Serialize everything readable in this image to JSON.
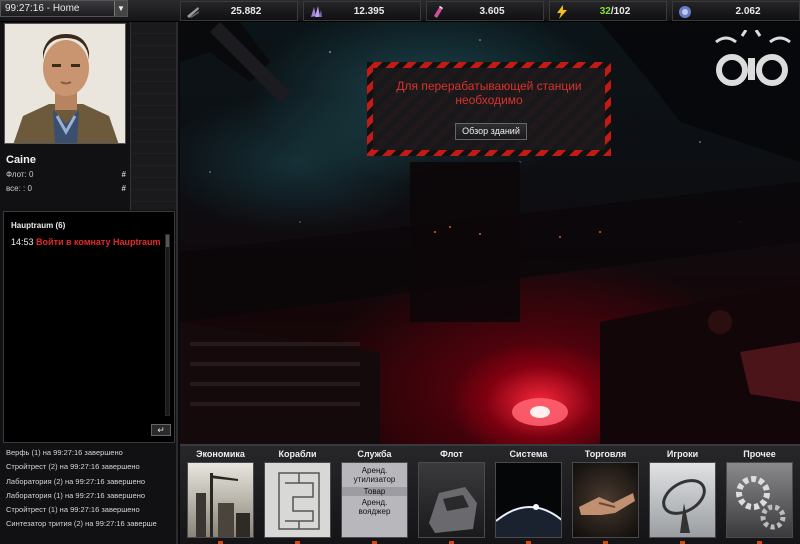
{
  "topbar": {
    "clock": "99:27:16 - Home",
    "dropdown_glyph": "▼",
    "resources": {
      "metal": "25.882",
      "crystal": "12.395",
      "tritium": "3.605",
      "energy_current": "32",
      "energy_max": "/102",
      "credits": "2.062"
    }
  },
  "player": {
    "name": "Caine",
    "fleet_label": "Флот: 0",
    "all_label": "все: : 0",
    "hash": "#"
  },
  "chat": {
    "title": "Hauptraum (6)",
    "time": "14:53",
    "message": "Войти в комнату Hauptraum",
    "send_glyph": "↵"
  },
  "events": [
    "Верфь (1) на 99:27:16 завершено",
    "Стройтрест (2) на 99:27:16 завершено",
    "Лаборатория (2) на 99:27:16 завершено",
    "Лаборатория (1) на 99:27:16 завершено",
    "Стройтрест (1) на 99:27:16 завершено",
    "Синтезатор трития (2) на 99:27:16 заверше"
  ],
  "notice": {
    "text": "Для перерабатывающей станции необходимо",
    "button": "Обзор зданий"
  },
  "nav": {
    "economy": "Экономика",
    "ships": "Корабли",
    "service": "Служба",
    "service_items": [
      "Аренд.",
      "утилизатор",
      "Товар",
      "Аренд.",
      "вояджер"
    ],
    "fleet": "Флот",
    "system": "Система",
    "trade": "Торговля",
    "players": "Игроки",
    "other": "Прочее"
  },
  "colors": {
    "accent_red": "#d8332e",
    "energy_green": "#7fe03a",
    "link_red": "#e02a2a"
  }
}
